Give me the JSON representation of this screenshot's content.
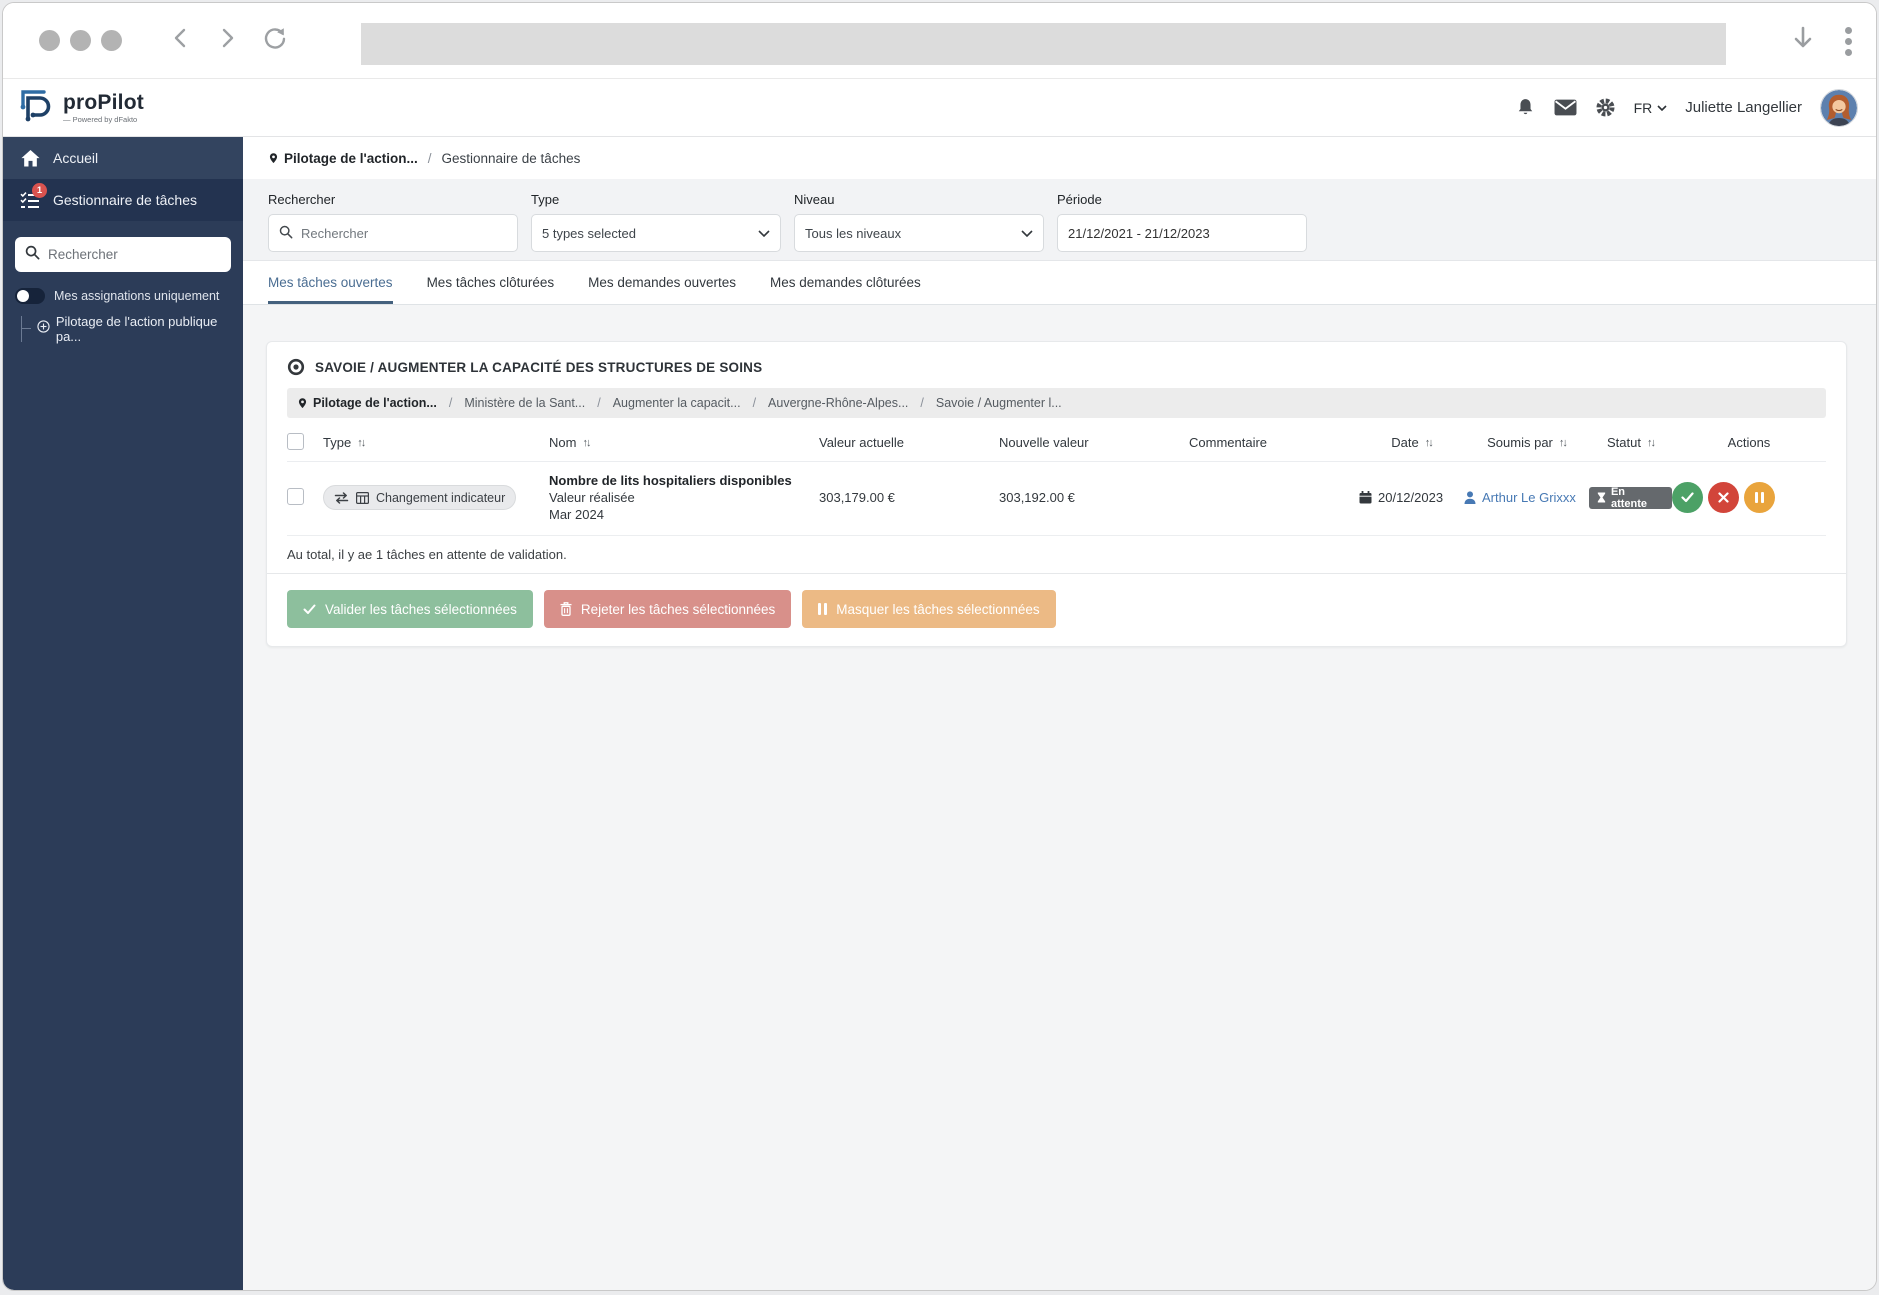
{
  "app_header": {
    "logo_text": "proPilot",
    "logo_tagline": "— Powered by dFakto",
    "language": "FR",
    "user_name": "Juliette Langellier"
  },
  "sidebar": {
    "items": [
      {
        "label": "Accueil"
      },
      {
        "label": "Gestionnaire de tâches",
        "badge": "1"
      }
    ],
    "search_placeholder": "Rechercher",
    "toggle_label": "Mes assignations uniquement",
    "tree_item": "Pilotage de l'action publique pa..."
  },
  "breadcrumb": {
    "root": "Pilotage de l'action...",
    "separator": "/",
    "current": "Gestionnaire de tâches"
  },
  "filters": {
    "search_label": "Rechercher",
    "search_placeholder": "Rechercher",
    "type_label": "Type",
    "type_value": "5 types selected",
    "level_label": "Niveau",
    "level_value": "Tous les niveaux",
    "period_label": "Période",
    "period_value": "21/12/2021 - 21/12/2023"
  },
  "tabs": [
    {
      "label": "Mes tâches ouvertes",
      "active": true
    },
    {
      "label": "Mes tâches clôturées",
      "active": false
    },
    {
      "label": "Mes demandes ouvertes",
      "active": false
    },
    {
      "label": "Mes demandes clôturées",
      "active": false
    }
  ],
  "card": {
    "title": "SAVOIE / AUGMENTER LA CAPACITÉ DES STRUCTURES DE SOINS",
    "path_separator": "/",
    "path": [
      {
        "label": "Pilotage de l'action..."
      },
      {
        "label": "Ministère de la Sant..."
      },
      {
        "label": "Augmenter la capacit..."
      },
      {
        "label": "Auvergne-Rhône-Alpes..."
      },
      {
        "label": "Savoie / Augmenter l..."
      }
    ],
    "table": {
      "sort_glyph": "↑↓",
      "headers": {
        "type": "Type",
        "name": "Nom",
        "current_value": "Valeur actuelle",
        "new_value": "Nouvelle valeur",
        "comment": "Commentaire",
        "date": "Date",
        "submitted_by": "Soumis par",
        "status": "Statut",
        "actions": "Actions"
      },
      "row": {
        "type_badge": "Changement indicateur",
        "name": "Nombre de lits hospitaliers disponibles",
        "name_line2": "Valeur réalisée",
        "name_line3": "Mar 2024",
        "current_value": "303,179.00 €",
        "new_value": "303,192.00 €",
        "comment": "",
        "date": "20/12/2023",
        "submitted_by": "Arthur Le Grixxx",
        "status": "En attente"
      }
    },
    "summary": "Au total, il y ae 1 tâches en attente de validation.",
    "actions": {
      "validate": "Valider les tâches sélectionnées",
      "reject": "Rejeter les tâches sélectionnées",
      "mask": "Masquer les tâches sélectionnées"
    }
  },
  "colors": {
    "sidebar_bg": "#2c3c58",
    "badge_red": "#d9534f",
    "link_blue": "#4779b4",
    "tab_active": "#44617e",
    "status_badge": "#65696d",
    "action_validate": "#4ca166",
    "action_reject": "#d2453a",
    "action_hold": "#e9a43c",
    "btn_validate": "#8dbf9d",
    "btn_reject": "#d8908a",
    "btn_mask": "#ecba85"
  }
}
